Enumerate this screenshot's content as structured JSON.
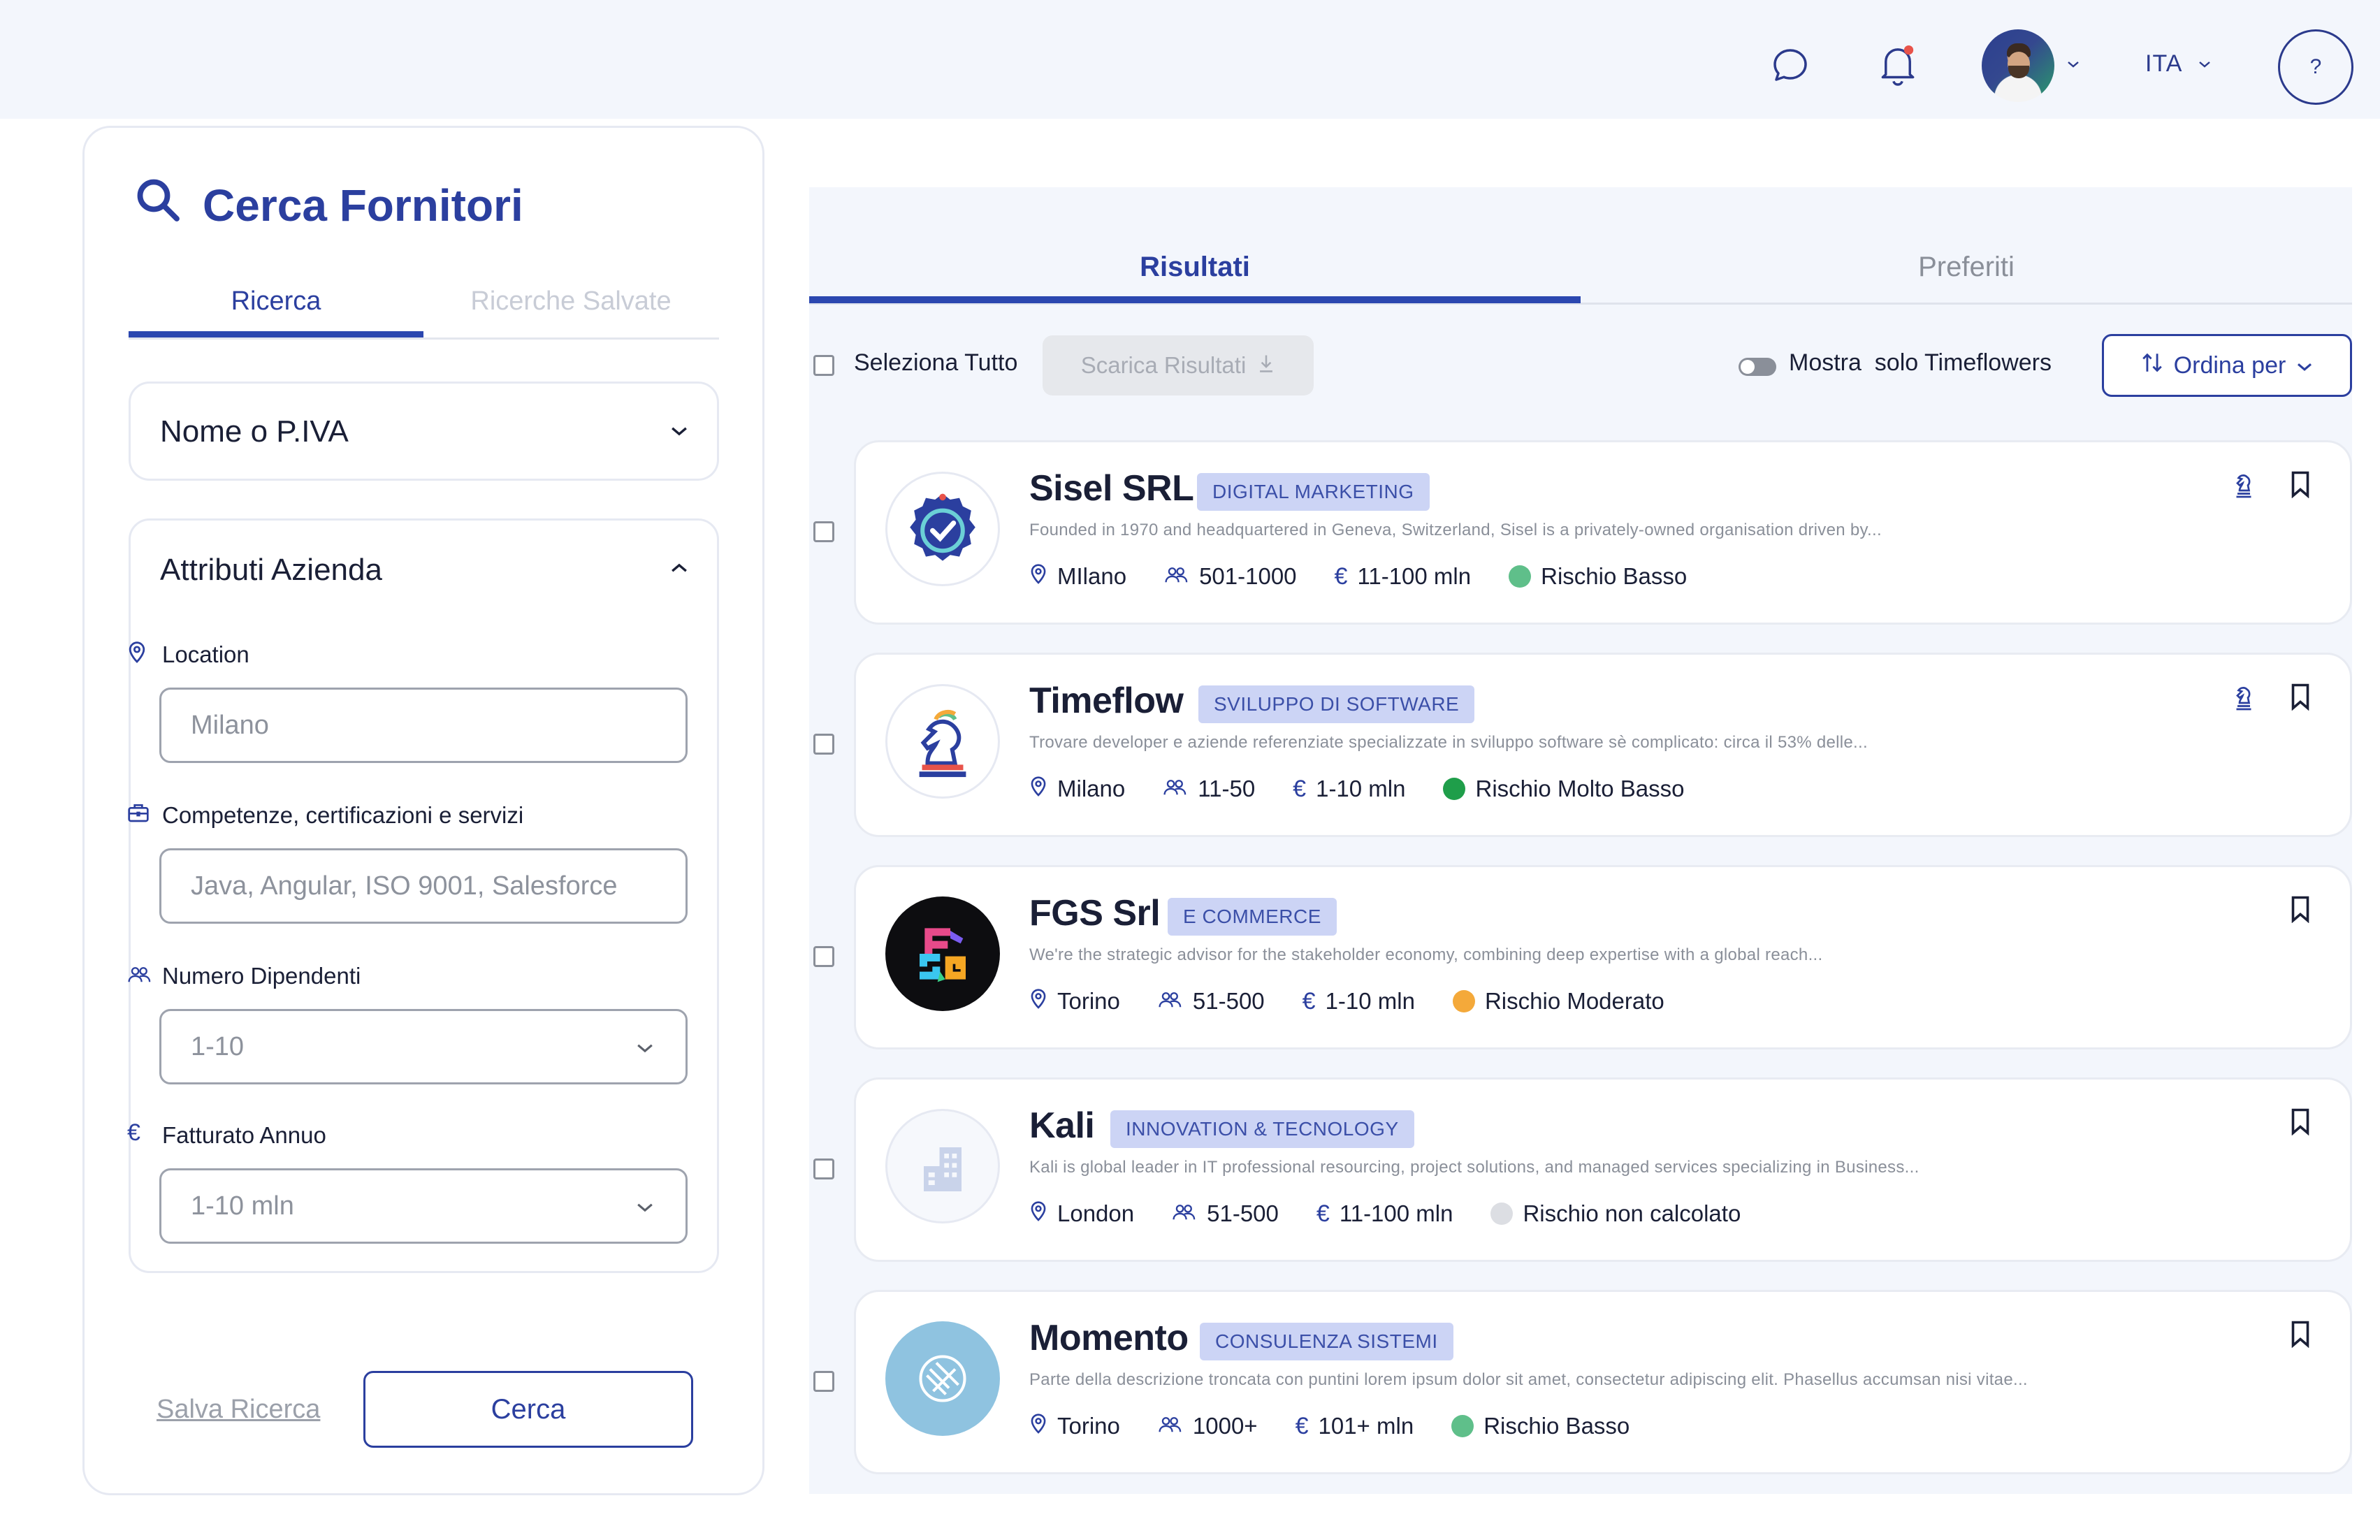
{
  "header": {
    "chat_icon": "chat-bubble-icon",
    "bell_icon": "bell-icon",
    "language": "ITA",
    "help": "?"
  },
  "left": {
    "title": "Cerca Fornitori",
    "tabs": [
      {
        "label": "Ricerca",
        "active": true
      },
      {
        "label": "Ricerche Salvate",
        "active": false
      }
    ],
    "accordion_name": "Nome o P.IVA",
    "accordion_attrs": "Attributi Azienda",
    "fields": {
      "location_label": "Location",
      "location_value": "Milano",
      "skills_label": "Competenze, certificazioni e servizi",
      "skills_placeholder": "Java, Angular, ISO 9001, Salesforce",
      "employees_label": "Numero Dipendenti",
      "employees_value": "1-10",
      "revenue_label": "Fatturato Annuo",
      "revenue_value": "1-10 mln"
    },
    "save_label": "Salva Ricerca",
    "search_button": "Cerca"
  },
  "results": {
    "tabs": [
      {
        "label": "Risultati",
        "active": true
      },
      {
        "label": "Preferiti",
        "active": false
      }
    ],
    "select_all": "Seleziona Tutto",
    "download": "Scarica Risultati",
    "toggle_label": "Mostra  solo Timeflowers",
    "sort": "Ordina per",
    "cards": [
      {
        "name": "Sisel SRL",
        "tag": "DIGITAL MARKETING",
        "desc": "Founded in 1970 and headquartered in Geneva, Switzerland, Sisel is a privately-owned organisation driven by...",
        "city": "MIlano",
        "employees": "501-1000",
        "revenue": "11-100 mln",
        "risk": "Rischio Basso",
        "risk_color": "#5fbf8a"
      },
      {
        "name": "Timeflow",
        "tag": "SVILUPPO DI SOFTWARE",
        "desc": "Trovare developer e aziende referenziate specializzate in sviluppo software sè complicato: circa il 53% delle...",
        "city": "Milano",
        "employees": "11-50",
        "revenue": "1-10 mln",
        "risk": "Rischio Molto Basso",
        "risk_color": "#1f9e4a"
      },
      {
        "name": "FGS Srl",
        "tag": "E COMMERCE",
        "desc": "We're the strategic advisor for the stakeholder economy, combining deep expertise with a global reach...",
        "city": "Torino",
        "employees": "51-500",
        "revenue": "1-10 mln",
        "risk": "Rischio Moderato",
        "risk_color": "#f4a93a"
      },
      {
        "name": "Kali",
        "tag": "INNOVATION & TECNOLOGY",
        "desc": "Kali is  global leader in IT professional resourcing, project solutions, and managed services specializing in Business...",
        "city": "London",
        "employees": "51-500",
        "revenue": "11-100 mln",
        "risk": "Rischio non calcolato",
        "risk_color": "#dcdee3"
      },
      {
        "name": "Momento",
        "tag": "CONSULENZA SISTEMI",
        "desc": "Parte della descrizione troncata con puntini lorem ipsum dolor sit amet, consectetur adipiscing elit. Phasellus accumsan nisi vitae...",
        "city": "Torino",
        "employees": "1000+",
        "revenue": "101+ mln",
        "risk": "Rischio Basso",
        "risk_color": "#5fbf8a"
      }
    ]
  },
  "colors": {
    "primary": "#2b3f9f",
    "accent": "#2b47b0",
    "background_soft": "#f3f6fc",
    "notification_dot": "#e8534a"
  }
}
